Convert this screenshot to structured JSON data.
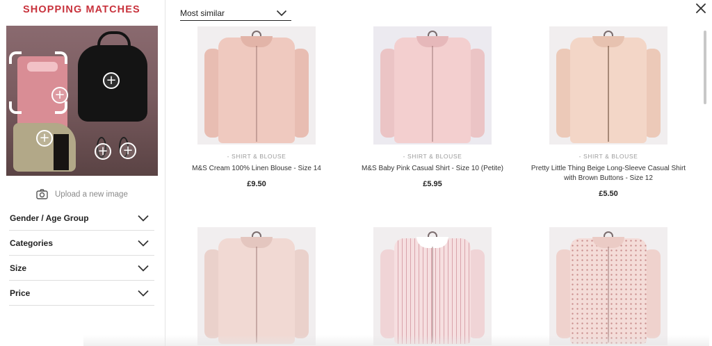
{
  "header": {
    "title": "SHOPPING MATCHES"
  },
  "sidebar": {
    "upload_label": "Upload a new image",
    "filters": [
      {
        "label": "Gender / Age Group"
      },
      {
        "label": "Categories"
      },
      {
        "label": "Size"
      },
      {
        "label": "Price"
      }
    ],
    "hotspot_symbol": "+"
  },
  "sort": {
    "selected": "Most similar"
  },
  "products": [
    {
      "category": "- SHIRT & BLOUSE",
      "title": "M&S Cream 100% Linen Blouse - Size 14",
      "price": "£9.50",
      "color": "#efc9bf"
    },
    {
      "category": "- SHIRT & BLOUSE",
      "title": "M&S Baby Pink Casual Shirt - Size 10 (Petite)",
      "price": "£5.95",
      "color": "#f3cfcf"
    },
    {
      "category": "- SHIRT & BLOUSE",
      "title": "Pretty Little Thing Beige Long-Sleeve Casual Shirt with Brown Buttons - Size 12",
      "price": "£5.50",
      "color": "#f3d6c7"
    },
    {
      "category": "",
      "title": "",
      "price": "",
      "color": "#f1d9d3"
    },
    {
      "category": "",
      "title": "",
      "price": "",
      "color": "#f6dfe0"
    },
    {
      "category": "",
      "title": "",
      "price": "",
      "color": "#f4dcd8"
    }
  ],
  "colors": {
    "brand": "#c8323c",
    "sidebar_border": "#e4e4e4"
  },
  "icons": {
    "close": "close-icon",
    "camera": "camera-icon",
    "chevron": "chevron-down-icon"
  }
}
